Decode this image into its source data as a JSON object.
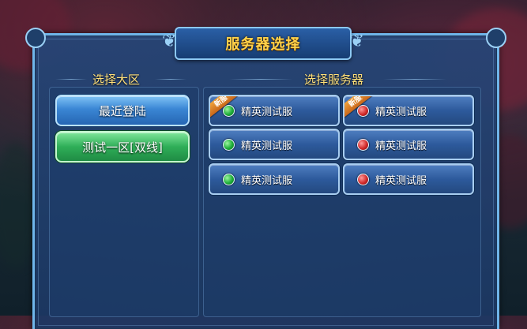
{
  "panel": {
    "title": "服务器选择",
    "accent_color": "#ffd24a"
  },
  "regions": {
    "heading": "选择大区",
    "items": [
      {
        "label": "最近登陆",
        "style": "blue"
      },
      {
        "label": "测试一区[双线]",
        "style": "green",
        "selected": true
      }
    ]
  },
  "servers": {
    "heading": "选择服务器",
    "items": [
      {
        "label": "精英测试服",
        "status": "green",
        "badge": "新服"
      },
      {
        "label": "精英测试服",
        "status": "red",
        "badge": "新服"
      },
      {
        "label": "精英测试服",
        "status": "green",
        "badge": ""
      },
      {
        "label": "精英测试服",
        "status": "red",
        "badge": ""
      },
      {
        "label": "精英测试服",
        "status": "green",
        "badge": ""
      },
      {
        "label": "精英测试服",
        "status": "red",
        "badge": ""
      }
    ],
    "status_colors": {
      "green": "#1fae3a",
      "red": "#d22b2b"
    }
  }
}
